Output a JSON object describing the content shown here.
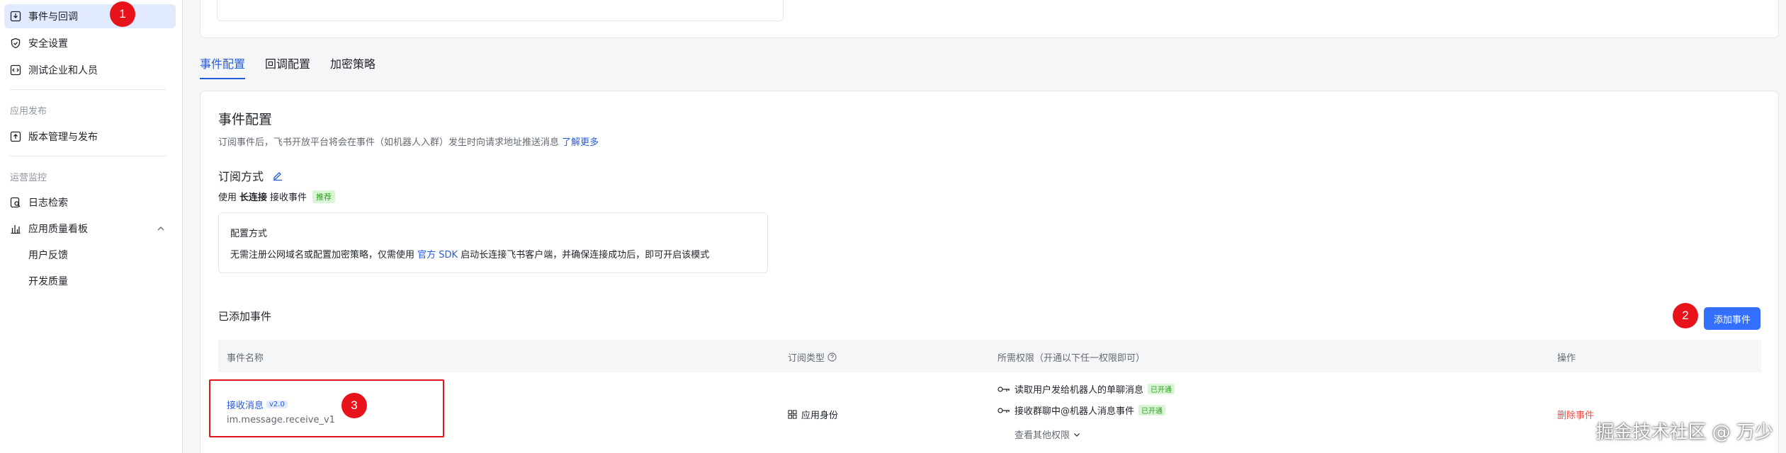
{
  "sidebar": {
    "items": [
      {
        "label": "事件与回调",
        "icon": "box-arrow-icon"
      },
      {
        "label": "安全设置",
        "icon": "shield-icon"
      },
      {
        "label": "测试企业和人员",
        "icon": "code-box-icon"
      }
    ],
    "section_publish": "应用发布",
    "publish_items": [
      {
        "label": "版本管理与发布",
        "icon": "upload-box-icon"
      }
    ],
    "section_monitor": "运营监控",
    "monitor_items": [
      {
        "label": "日志检索",
        "icon": "log-search-icon"
      },
      {
        "label": "应用质量看板",
        "icon": "bar-chart-icon"
      },
      {
        "label": "用户反馈"
      },
      {
        "label": "开发质量"
      }
    ]
  },
  "annotations": [
    "1",
    "2",
    "3"
  ],
  "tabs": [
    "事件配置",
    "回调配置",
    "加密策略"
  ],
  "section": {
    "title": "事件配置",
    "desc": "订阅事件后，飞书开放平台将会在事件（如机器人入群）发生时向请求地址推送消息",
    "desc_link": "了解更多",
    "sub_title": "订阅方式",
    "use_prefix": "使用",
    "use_bold": "长连接",
    "use_suffix": "接收事件",
    "use_tag": "推荐",
    "cfg_title": "配置方式",
    "cfg_desc_pre": "无需注册公网域名或配置加密策略，仅需使用",
    "cfg_desc_link": "官方 SDK",
    "cfg_desc_post": "启动长连接飞书客户端，并确保连接成功后，即可开启该模式"
  },
  "added": {
    "title": "已添加事件",
    "add_button": "添加事件"
  },
  "table": {
    "headers": [
      "事件名称",
      "订阅类型",
      "所需权限（开通以下任一权限即可）",
      "操作"
    ],
    "rows": [
      {
        "name": "接收消息",
        "version": "v2.0",
        "id": "im.message.receive_v1",
        "sub_type": "应用身份",
        "perms": [
          {
            "label": "读取用户发给机器人的单聊消息",
            "status": "已开通"
          },
          {
            "label": "接收群聊中@机器人消息事件",
            "status": "已开通"
          }
        ],
        "more": "查看其他权限",
        "action": "删除事件"
      }
    ]
  },
  "watermark": "掘金技术社区 @ 万少"
}
